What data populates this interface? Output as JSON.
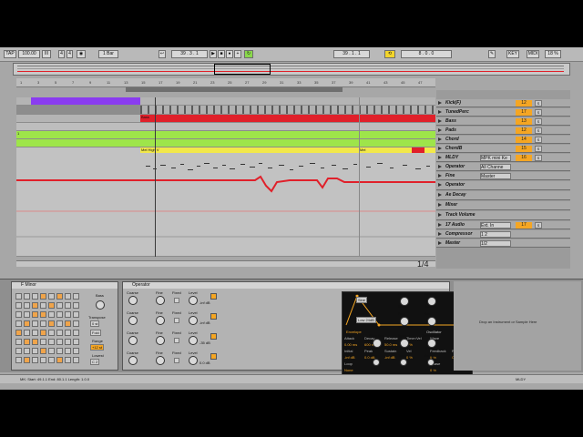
{
  "transport": {
    "tap": "TAP",
    "tempo": "100.00",
    "meter_num": "4",
    "meter_den": "4",
    "metro": "1 Bar",
    "position": "39 . 3 . 1",
    "loop_start": "39 . 1 . 1",
    "loop_length": "8 . 0 . 0",
    "key": "KEY",
    "midi": "MIDI",
    "cpu": "18 %"
  },
  "tracks": [
    {
      "name": "Kick(F)",
      "num": "12",
      "io": ""
    },
    {
      "name": "TunedPerc",
      "num": "17",
      "io": ""
    },
    {
      "name": "Bass",
      "num": "13",
      "io": ""
    },
    {
      "name": "Pads",
      "num": "12",
      "io": ""
    },
    {
      "name": "Chord",
      "num": "14",
      "io": ""
    },
    {
      "name": "ChordB",
      "num": "15",
      "io": ""
    },
    {
      "name": "MLDY",
      "num": "16",
      "io": "MPK mini Ke"
    },
    {
      "name": "Operator",
      "num": "",
      "io": "All Channe"
    },
    {
      "name": "Fine",
      "num": "",
      "io": "Master"
    },
    {
      "name": "Operator",
      "num": "",
      "io": ""
    },
    {
      "name": "Ae Decay",
      "num": "",
      "io": ""
    },
    {
      "name": "Mixer",
      "num": "",
      "io": ""
    },
    {
      "name": "Track Volume",
      "num": "",
      "io": ""
    },
    {
      "name": "17 Audio",
      "num": "17",
      "io": "Ext. In"
    },
    {
      "name": "Compressor",
      "num": "",
      "io": "1 2"
    },
    {
      "name": "Master",
      "num": "",
      "io": "1/2"
    }
  ],
  "clips": {
    "bass": "Bass",
    "chord": "1",
    "mldy_a": "Mel High V",
    "mldy_b": "Mel"
  },
  "quantize": "1/4",
  "ruler_ticks": [
    "1",
    "3",
    "5",
    "7",
    "9",
    "11",
    "13",
    "15",
    "17",
    "19",
    "21",
    "23",
    "25",
    "27",
    "29",
    "31",
    "33",
    "35",
    "37",
    "39",
    "41",
    "43",
    "45",
    "47"
  ],
  "devices": {
    "drum": {
      "title": "F Minor",
      "bass_label": "Bass",
      "transpose_label": "Transpose",
      "transpose_val": "0 st",
      "fold": "Fold",
      "range": "Range",
      "range_val": "+12 st",
      "lowest": "Lowest",
      "lowest_val": "C 2"
    },
    "operator": {
      "title": "Operator",
      "osc": [
        {
          "coarse": "Coarse",
          "fine": "Fine",
          "fixed": "Fixed",
          "level": "Level",
          "coarse_val": "1",
          "fine_val": "0",
          "level_val": "-inf dB"
        },
        {
          "coarse": "Coarse",
          "fine": "Fine",
          "fixed": "Fixed",
          "level": "Level",
          "coarse_val": "1",
          "fine_val": "0",
          "level_val": "-inf dB"
        },
        {
          "coarse": "Coarse",
          "fine": "Fine",
          "fixed": "Fixed",
          "level": "Level",
          "coarse_val": "1",
          "fine_val": "0",
          "level_val": "-35 dB"
        },
        {
          "coarse": "Coarse",
          "fine": "Fine",
          "fixed": "Fixed",
          "level": "Level",
          "coarse_val": "1",
          "fine_val": "0",
          "level_val": "0.0 dB"
        }
      ],
      "env_tab": "Envelope",
      "osc_tab": "Oscillator",
      "env_params": {
        "attack": "Attack",
        "decay": "Decay",
        "release": "Release",
        "time_vel": "Time<Vel",
        "wave": "Wave",
        "attack_val": "0.00 ms",
        "decay_val": "600 ms",
        "release_val": "50.0 ms",
        "time_vel_val": "0 %",
        "wave_val": "Sin",
        "initial": "Initial",
        "peak": "Peak",
        "sustain": "Sustain",
        "vel": "Vel",
        "feedback": "Feedback",
        "repeat": "Repeat",
        "initial_val": "-inf dB",
        "peak_val": "0.0 dB",
        "sustain_val": "-inf dB",
        "vel_val": "0 %",
        "feedback_val": "0 %",
        "repeat_val": "Off",
        "loop": "Loop",
        "loop_val": "None",
        "phase": "Phase",
        "phase_val": "0 %"
      },
      "lfo": "LFO",
      "lfo_wave": "Sine",
      "rate": "Rate",
      "rate_val": "84.00",
      "amount": "Amount",
      "amount_val": "100 %",
      "filter": "Filter",
      "filter_type": "Low 24dB",
      "freq": "Freq",
      "freq_val": "18.5 kHz",
      "res": "Res",
      "res_val": "0.0 %",
      "pitch_env": "Pitch Env",
      "pitch_env_val": "0 %",
      "spread": "Spread",
      "spread_val": "0 %",
      "transpose": "Transpose",
      "transpose_val": "0 st",
      "time": "Time",
      "time_val": "0 %",
      "tone": "Tone",
      "tone_val": "70 %",
      "volume": "Volume",
      "volume_val": "-12 dB"
    },
    "drop_text": "Drop an Instrument or Sample Here"
  },
  "status": {
    "info": "MK: Start: 49.1.1  End: 80.1.1  Length: 1.0.0",
    "track": "MLDY"
  },
  "colors": {
    "purple": "#8a3cf0",
    "red": "#e0202a",
    "green": "#9ee54a",
    "yellow": "#f2e84a",
    "orange": "#f5a623"
  }
}
